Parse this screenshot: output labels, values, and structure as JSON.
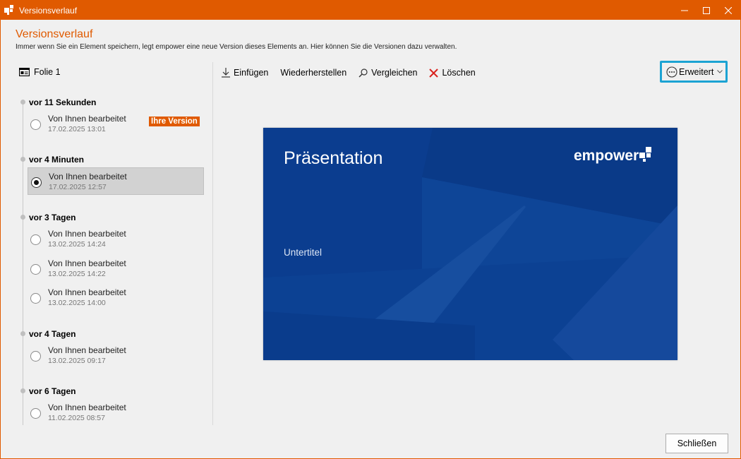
{
  "window": {
    "title": "Versionsverlauf",
    "accent_color": "#e05a00"
  },
  "header": {
    "title": "Versionsverlauf",
    "subtitle": "Immer wenn Sie ein Element speichern, legt empower eine neue Version dieses Elements an. Hier können Sie die Versionen dazu verwalten."
  },
  "element": {
    "label": "Folie 1",
    "icon": "slide-icon"
  },
  "toolbar": {
    "insert_label": "Einfügen",
    "restore_label": "Wiederherstellen",
    "compare_label": "Vergleichen",
    "delete_label": "Löschen",
    "advanced_label": "Erweitert"
  },
  "groups": [
    {
      "label": "vor 11 Sekunden",
      "entries": [
        {
          "title": "Von Ihnen bearbeitet",
          "date": "17.02.2025 13:01",
          "badge": "Ihre Version",
          "selected": false
        }
      ]
    },
    {
      "label": "vor 4 Minuten",
      "entries": [
        {
          "title": "Von Ihnen bearbeitet",
          "date": "17.02.2025 12:57",
          "selected": true
        }
      ]
    },
    {
      "label": "vor 3 Tagen",
      "entries": [
        {
          "title": "Von Ihnen bearbeitet",
          "date": "13.02.2025 14:24",
          "selected": false
        },
        {
          "title": "Von Ihnen bearbeitet",
          "date": "13.02.2025 14:22",
          "selected": false
        },
        {
          "title": "Von Ihnen bearbeitet",
          "date": "13.02.2025 14:00",
          "selected": false
        }
      ]
    },
    {
      "label": "vor 4 Tagen",
      "entries": [
        {
          "title": "Von Ihnen bearbeitet",
          "date": "13.02.2025 09:17",
          "selected": false
        }
      ]
    },
    {
      "label": "vor 6 Tagen",
      "entries": [
        {
          "title": "Von Ihnen bearbeitet",
          "date": "11.02.2025 08:57",
          "selected": false
        }
      ]
    }
  ],
  "preview": {
    "title": "Präsentation",
    "subtitle": "Untertitel",
    "logo_text": "empower",
    "background_color": "#0b3d8f"
  },
  "footer": {
    "close_label": "Schließen"
  }
}
